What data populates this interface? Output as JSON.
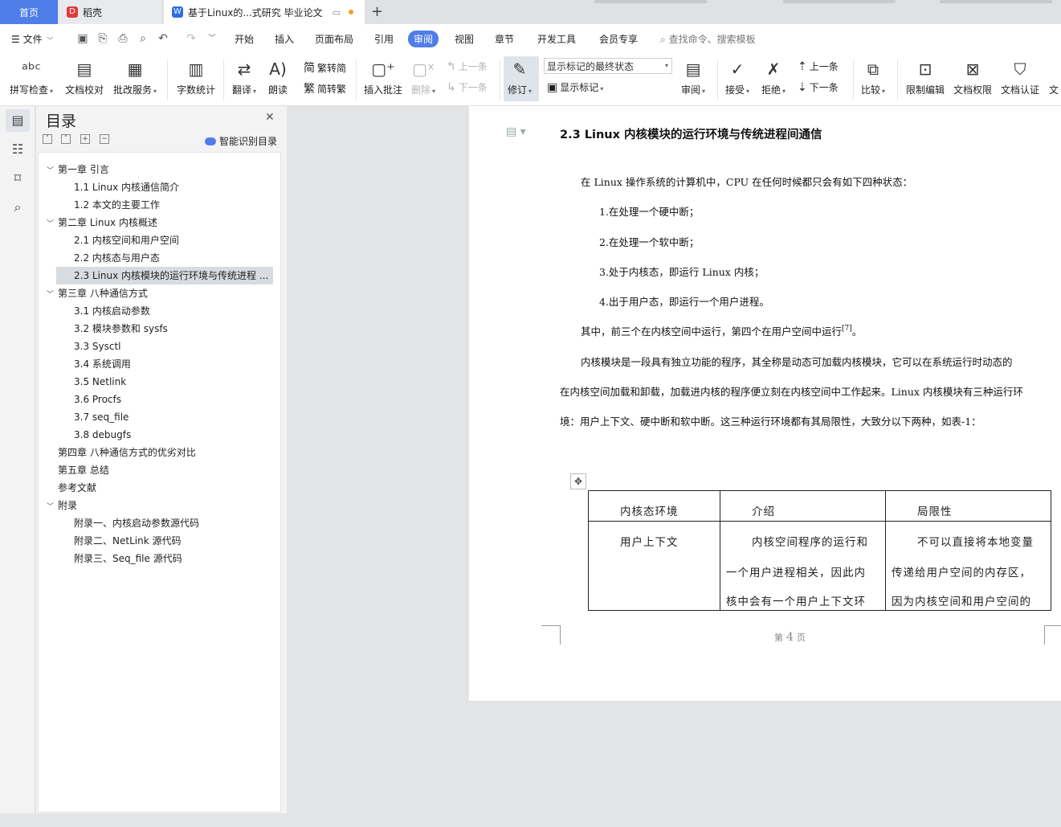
{
  "tabs": [
    {
      "label": "首页"
    },
    {
      "label": "稻壳"
    },
    {
      "label": "基于Linux的...式研究 毕业论文"
    }
  ],
  "menu": {
    "file": "文件",
    "items": [
      "开始",
      "插入",
      "页面布局",
      "引用",
      "审阅",
      "视图",
      "章节",
      "开发工具",
      "会员专享"
    ],
    "search": "查找命令、搜索模板"
  },
  "ribbon": {
    "spell": "拼写检查",
    "proof": "文档校对",
    "correct": "批改服务",
    "wordcount": "字数统计",
    "translate": "翻译",
    "read": "朗读",
    "to_trad": "繁转简",
    "to_simp": "简转繁",
    "insert_comment": "插入批注",
    "delete": "删除",
    "prev_comment": "上一条",
    "next_comment": "下一条",
    "revise": "修订",
    "markup_state": "显示标记的最终状态",
    "show_markup": "显示标记",
    "review": "审阅",
    "accept": "接受",
    "reject": "拒绝",
    "prev_change": "上一条",
    "next_change": "下一条",
    "compare": "比较",
    "restrict": "限制编辑",
    "permission": "文档权限",
    "certify": "文档认证",
    "more": "文"
  },
  "toc": {
    "title": "目录",
    "smart": "智能识别目录",
    "items": [
      {
        "label": "第一章  引言",
        "arrow": "﹀"
      },
      {
        "label": "1.1 Linux 内核通信简介",
        "arrow": ""
      },
      {
        "label": "1.2  本文的主要工作",
        "arrow": ""
      },
      {
        "label": "第二章  Linux 内核概述",
        "arrow": "﹀"
      },
      {
        "label": "2.1  内核空间和用户空间",
        "arrow": ""
      },
      {
        "label": "2.2  内核态与用户态",
        "arrow": ""
      },
      {
        "label": "2.3 Linux  内核模块的运行环境与传统进程 ...",
        "arrow": ""
      },
      {
        "label": "第三章  八种通信方式",
        "arrow": "﹀"
      },
      {
        "label": "3.1  内核启动参数",
        "arrow": ""
      },
      {
        "label": "3.2  模块参数和 sysfs",
        "arrow": ""
      },
      {
        "label": "3.3 Sysctl",
        "arrow": ""
      },
      {
        "label": "3.4  系统调用",
        "arrow": ""
      },
      {
        "label": "3.5 Netlink",
        "arrow": ""
      },
      {
        "label": "3.6 Procfs",
        "arrow": ""
      },
      {
        "label": "3.7 seq_file",
        "arrow": ""
      },
      {
        "label": "3.8 debugfs",
        "arrow": ""
      },
      {
        "label": "第四章  八种通信方式的优劣对比",
        "arrow": ""
      },
      {
        "label": "第五章  总结",
        "arrow": ""
      },
      {
        "label": "参考文献",
        "arrow": ""
      },
      {
        "label": "附录",
        "arrow": "﹀"
      },
      {
        "label": "附录一、内核启动参数源代码",
        "arrow": ""
      },
      {
        "label": "附录二、NetLink  源代码",
        "arrow": ""
      },
      {
        "label": "附录三、Seq_file  源代码",
        "arrow": ""
      }
    ]
  },
  "doc": {
    "heading": "2.3 Linux  内核模块的运行环境与传统进程间通信",
    "p1": "在 Linux 操作系统的计算机中，CPU 在任何时候都只会有如下四种状态：",
    "s1": "1.在处理一个硬中断；",
    "s2": "2.在处理一个软中断；",
    "s3": "3.处于内核态，即运行 Linux 内核；",
    "s4": "4.出于用户态，即运行一个用户进程。",
    "p2": "其中，前三个在内核空间中运行，第四个在用户空间中运行",
    "p2_ref": "[7]",
    "p2_end": "。",
    "p3a": "内核模块是一段具有独立功能的程序，其全称是动态可加载内核模块，它可以在系统运行时动态的",
    "p3b": "在内核空间加载和卸载，加载进内核的程序便立刻在内核空间中工作起来。Linux 内核模块有三种运行环",
    "p3c": "境：用户上下文、硬中断和软中断。这三种运行环境都有其局限性，大致分以下两种，如表-1：",
    "table": {
      "h1": "内核态环境",
      "h2": "介绍",
      "h3": "局限性",
      "c1": "用户上下文",
      "c2a": "内核空间程序的运行和",
      "c2b": "一个用户进程相关，因此内",
      "c2c": "核中会有一个用户上下文环",
      "c3a": "不可以直接将本地变量",
      "c3b": "传递给用户空间的内存区，",
      "c3c": "因为内核空间和用户空间的"
    },
    "footer_pre": "第",
    "page_no": "4",
    "footer_post": "页"
  }
}
